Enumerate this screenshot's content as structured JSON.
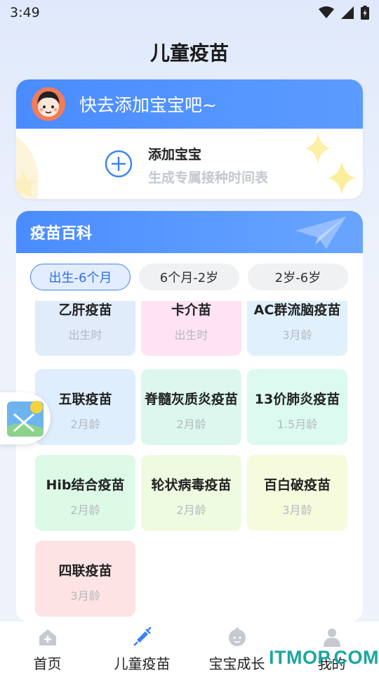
{
  "status_bar": {
    "time": "3:49"
  },
  "page_title": "儿童疫苗",
  "baby_card": {
    "prompt": "快去添加宝宝吧~",
    "add_title": "添加宝宝",
    "add_subtitle": "生成专属接种时间表"
  },
  "encyclopedia": {
    "title": "疫苗百科",
    "tabs": [
      "出生-6个月",
      "6个月-2岁",
      "2岁-6岁"
    ],
    "active_tab": 0,
    "vaccines": [
      {
        "name": "乙肝疫苗",
        "age": "出生时",
        "color": "#e1ecfb"
      },
      {
        "name": "卡介苗",
        "age": "出生时",
        "color": "#fde3f3"
      },
      {
        "name": "AC群流脑疫苗",
        "age": "3月龄",
        "color": "#e0f1fd"
      },
      {
        "name": "五联疫苗",
        "age": "2月龄",
        "color": "#dfeefd"
      },
      {
        "name": "脊髓灰质炎疫苗",
        "age": "2月龄",
        "color": "#dcf8ee"
      },
      {
        "name": "13价肺炎疫苗",
        "age": "1.5月龄",
        "color": "#dcfaf0"
      },
      {
        "name": "Hib结合疫苗",
        "age": "2月龄",
        "color": "#dcfae6"
      },
      {
        "name": "轮状病毒疫苗",
        "age": "2月龄",
        "color": "#eefbe0"
      },
      {
        "name": "百白破疫苗",
        "age": "3月龄",
        "color": "#f5fbdc"
      },
      {
        "name": "四联疫苗",
        "age": "3月龄",
        "color": "#fde3e3"
      }
    ]
  },
  "bottom_nav": [
    {
      "label": "首页",
      "icon": "home-icon",
      "active": false
    },
    {
      "label": "儿童疫苗",
      "icon": "syringe-icon",
      "active": true
    },
    {
      "label": "宝宝成长",
      "icon": "baby-face-icon",
      "active": false
    },
    {
      "label": "我的",
      "icon": "person-icon",
      "active": false
    }
  ],
  "watermark": "ITMOP.COM",
  "colors": {
    "accent": "#4a8cff",
    "active_tab_border": "#3f86f5",
    "active_nav": "#3b82f6",
    "watermark": "#1aa6a0"
  }
}
